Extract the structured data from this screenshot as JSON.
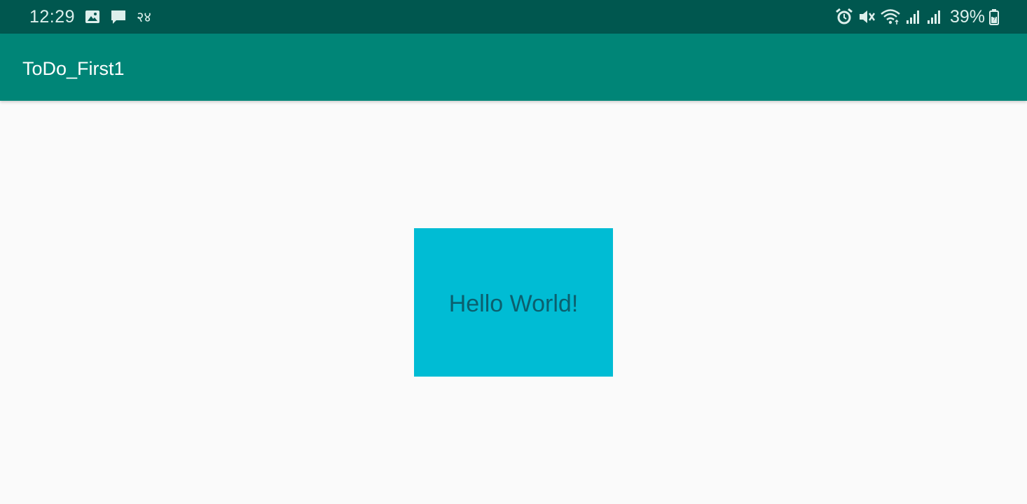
{
  "status_bar": {
    "time": "12:29",
    "battery": "39%",
    "left_icons": [
      "image-icon",
      "message-icon",
      "lte-icon"
    ],
    "right_icons": [
      "alarm-icon",
      "mute-icon",
      "wifi-icon",
      "signal-icon",
      "signal-icon-2",
      "battery-icon"
    ],
    "lte_text": "ᖬᖆ"
  },
  "app_bar": {
    "title": "ToDo_First1",
    "color": "#008577"
  },
  "main": {
    "hello_text": "Hello World!",
    "box_color": "#00BCD4"
  }
}
